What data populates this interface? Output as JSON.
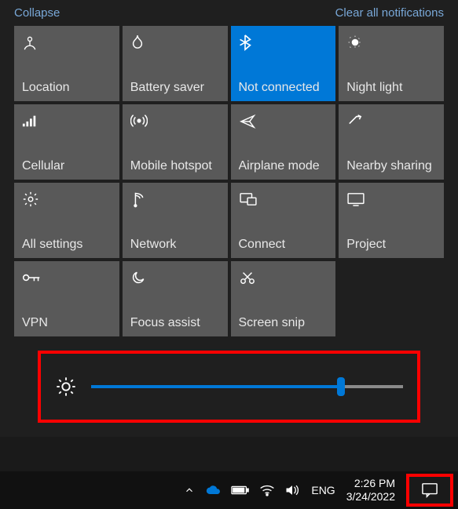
{
  "header": {
    "collapse": "Collapse",
    "clear": "Clear all notifications"
  },
  "tiles": [
    {
      "icon": "location",
      "label": "Location",
      "active": false
    },
    {
      "icon": "battery-saver",
      "label": "Battery saver",
      "active": false
    },
    {
      "icon": "bluetooth",
      "label": "Not connected",
      "active": true
    },
    {
      "icon": "night-light",
      "label": "Night light",
      "active": false
    },
    {
      "icon": "cellular",
      "label": "Cellular",
      "active": false
    },
    {
      "icon": "hotspot",
      "label": "Mobile hotspot",
      "active": false
    },
    {
      "icon": "airplane",
      "label": "Airplane mode",
      "active": false
    },
    {
      "icon": "nearby",
      "label": "Nearby sharing",
      "active": false
    },
    {
      "icon": "settings",
      "label": "All settings",
      "active": false
    },
    {
      "icon": "network",
      "label": "Network",
      "active": false
    },
    {
      "icon": "connect",
      "label": "Connect",
      "active": false
    },
    {
      "icon": "project",
      "label": "Project",
      "active": false
    },
    {
      "icon": "vpn",
      "label": "VPN",
      "active": false
    },
    {
      "icon": "focus",
      "label": "Focus assist",
      "active": false
    },
    {
      "icon": "snip",
      "label": "Screen snip",
      "active": false
    }
  ],
  "brightness": {
    "percent": 80
  },
  "taskbar": {
    "language": "ENG",
    "time": "2:26 PM",
    "date": "3/24/2022"
  }
}
